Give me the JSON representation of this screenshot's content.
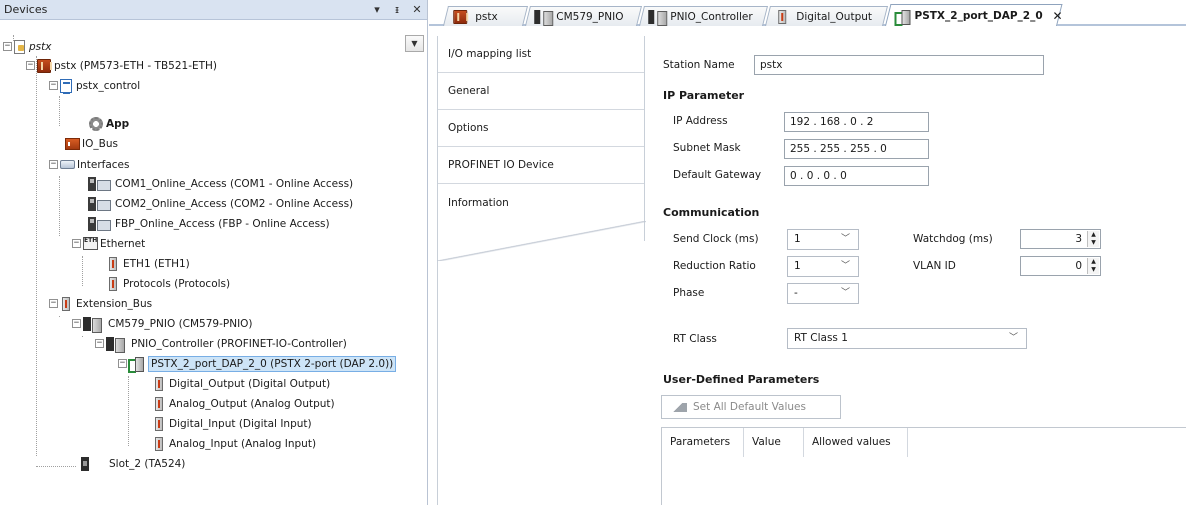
{
  "devices_pane": {
    "title": "Devices",
    "buttons": {
      "dropdown": "▾",
      "pin": "ᵻ",
      "close": "✕"
    }
  },
  "tree": {
    "dropdown": "▼",
    "nodes": [
      {
        "label": "pstx",
        "icon": "project-icon"
      },
      {
        "label": "pstx (PM573-ETH - TB521-ETH)",
        "icon": "plc-icon"
      },
      {
        "label": "pstx_control",
        "icon": "application-icon"
      },
      {
        "label": "App",
        "icon": "gear-icon"
      },
      {
        "label": "IO_Bus",
        "icon": "io-bus-icon"
      },
      {
        "label": "Interfaces",
        "icon": "interfaces-icon"
      },
      {
        "label": "COM1_Online_Access (COM1 - Online Access)",
        "icon": "serial-port-icon"
      },
      {
        "label": "COM2_Online_Access (COM2 - Online Access)",
        "icon": "serial-port-icon"
      },
      {
        "label": "FBP_Online_Access (FBP - Online Access)",
        "icon": "serial-port-icon"
      },
      {
        "label": "Ethernet",
        "icon": "ethernet-icon"
      },
      {
        "label": "ETH1 (ETH1)",
        "icon": "module-icon"
      },
      {
        "label": "Protocols (Protocols)",
        "icon": "module-icon"
      },
      {
        "label": "Extension_Bus",
        "icon": "module-icon"
      },
      {
        "label": "CM579_PNIO (CM579-PNIO)",
        "icon": "communication-module-icon"
      },
      {
        "label": "PNIO_Controller (PROFINET-IO-Controller)",
        "icon": "profinet-controller-icon"
      },
      {
        "label": "PSTX_2_port_DAP_2_0 (PSTX 2-port (DAP 2.0))",
        "icon": "profinet-device-icon"
      },
      {
        "label": "Digital_Output (Digital Output)",
        "icon": "module-icon"
      },
      {
        "label": "Analog_Output (Analog Output)",
        "icon": "module-icon"
      },
      {
        "label": "Digital_Input (Digital Input)",
        "icon": "module-icon"
      },
      {
        "label": "Analog_Input (Analog Input)",
        "icon": "module-icon"
      },
      {
        "label": "Slot_2 (TA524)",
        "icon": "slot-icon"
      }
    ]
  },
  "tabs": [
    {
      "label": "pstx",
      "icon": "plc-icon"
    },
    {
      "label": "CM579_PNIO",
      "icon": "communication-module-icon"
    },
    {
      "label": "PNIO_Controller",
      "icon": "profinet-controller-icon"
    },
    {
      "label": "Digital_Output",
      "icon": "module-icon"
    },
    {
      "label": "PSTX_2_port_DAP_2_0",
      "icon": "profinet-device-icon",
      "close": "✕"
    }
  ],
  "side_tabs": [
    "I/O mapping list",
    "General",
    "Options",
    "PROFINET IO Device",
    "Information"
  ],
  "general": {
    "station_name": {
      "label": "Station Name",
      "value": "pstx"
    },
    "ip_section": "IP Parameter",
    "ip_address": {
      "label": "IP Address",
      "value": "192  .  168  .   0   .   2"
    },
    "subnet_mask": {
      "label": "Subnet Mask",
      "value": "255  .  255  .  255  .   0"
    },
    "default_gateway": {
      "label": "Default Gateway",
      "value": " 0   .   0   .   0   .   0"
    },
    "comm_section": "Communication",
    "send_clock": {
      "label": "Send Clock (ms)",
      "value": "1"
    },
    "reduction_ratio": {
      "label": "Reduction Ratio",
      "value": "1"
    },
    "phase": {
      "label": "Phase",
      "value": "-"
    },
    "watchdog": {
      "label": "Watchdog (ms)",
      "value": "3"
    },
    "vlan_id": {
      "label": "VLAN ID",
      "value": "0"
    },
    "rt_class": {
      "label": "RT Class",
      "value": "RT Class 1"
    },
    "user_section": "User-Defined Parameters",
    "set_defaults": "Set All Default Values",
    "table_headers": [
      "Parameters",
      "Value",
      "Allowed values"
    ]
  },
  "colors": {
    "selection": "#cde4f7",
    "header_bg": "#d9e3f1",
    "accent_border": "#78aee5"
  }
}
